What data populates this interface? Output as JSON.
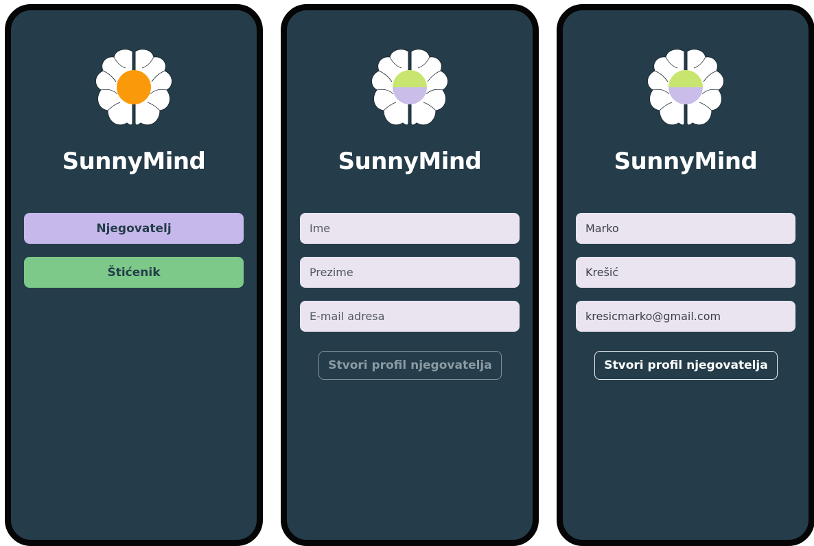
{
  "colors": {
    "screen_bg": "#253d4a",
    "caregiver_button": "#c6b8ea",
    "ward_button": "#7cc98a",
    "input_bg": "#e9e4ef",
    "logo_orange": "#fa9a0a",
    "logo_green": "#c8e66f",
    "logo_lavender": "#cbbde9"
  },
  "screens": [
    {
      "app_name": "SunnyMind",
      "logo_icon": "brain-flower-icon",
      "buttons": [
        {
          "label": "Njegovatelj",
          "color": "#c6b8ea"
        },
        {
          "label": "Štićenik",
          "color": "#7cc98a"
        }
      ]
    },
    {
      "app_name": "SunnyMind",
      "logo_icon": "brain-flower-icon",
      "fields": [
        {
          "placeholder": "Ime"
        },
        {
          "placeholder": "Prezime"
        },
        {
          "placeholder": "E-mail adresa"
        }
      ],
      "submit_label": "Stvori profil njegovatelja",
      "submit_state": "disabled"
    },
    {
      "app_name": "SunnyMind",
      "logo_icon": "brain-flower-icon",
      "fields": [
        {
          "value": "Marko"
        },
        {
          "value": "Krešić"
        },
        {
          "value": "kresicmarko@gmail.com"
        }
      ],
      "submit_label": "Stvori profil njegovatelja",
      "submit_state": "enabled"
    }
  ]
}
